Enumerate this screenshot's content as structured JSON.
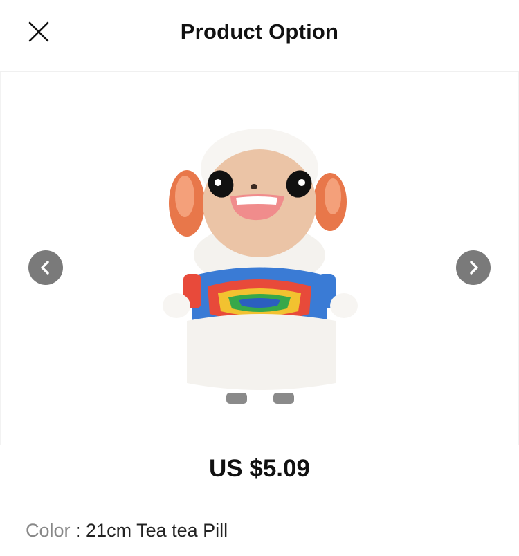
{
  "header": {
    "title": "Product Option",
    "close_icon": "close-icon"
  },
  "gallery": {
    "image_alt": "plush sheep toy with rainbow tie-dye shirt",
    "prev_icon": "chevron-left-icon",
    "next_icon": "chevron-right-icon"
  },
  "product": {
    "price": "US $5.09"
  },
  "option": {
    "label": "Color",
    "separator": " : ",
    "value": "21cm Tea tea Pill"
  },
  "colors": {
    "arrow_bg": "#7a7a7a",
    "text_primary": "#111111",
    "label_gray": "#888888"
  }
}
